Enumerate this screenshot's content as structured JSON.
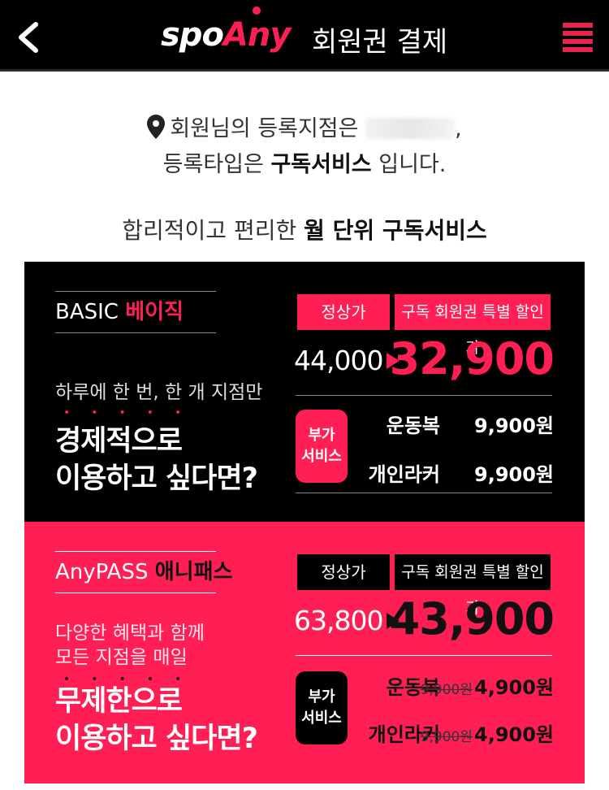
{
  "header": {
    "logo_left": "spo",
    "logo_right": "Any",
    "title": "회원권 결제"
  },
  "info": {
    "line1_text": "회원님의 등록지점은",
    "line2_prefix": "등록타입은",
    "line2_type": "구독서비스",
    "line2_suffix": "입니다."
  },
  "subtitle": {
    "prefix": "합리적이고 편리한",
    "bold": "월 단위 구독서비스"
  },
  "plans": {
    "basic": {
      "name_en": "BASIC",
      "name_ko": "베이직",
      "tagline": [
        "하루에 한 번, 한 개 지점만"
      ],
      "headline": [
        "경제적으로",
        "이용하고 싶다면?"
      ],
      "label_regular": "정상가",
      "label_discount": "구독 회원권 특별 할인가",
      "old_price": "44,000",
      "new_price": "32,900",
      "badge": [
        "부가",
        "서비스"
      ],
      "services": [
        {
          "name": "운동복",
          "old_price": "",
          "price": "9,900원"
        },
        {
          "name": "개인라커",
          "old_price": "",
          "price": "9,900원"
        }
      ]
    },
    "anypass": {
      "name_en": "AnyPASS",
      "name_ko": "애니패스",
      "tagline": [
        "다양한 혜택과 함께",
        "모든 지점을 매일"
      ],
      "headline": [
        "무제한으로",
        "이용하고 싶다면?"
      ],
      "label_regular": "정상가",
      "label_discount": "구독 회원권 특별 할인가",
      "old_price": "63,800",
      "new_price": "43,900",
      "badge": [
        "부가",
        "서비스"
      ],
      "services": [
        {
          "name": "운동복",
          "old_price": "9,900원",
          "price": "4,900원"
        },
        {
          "name": "개인라커",
          "old_price": "9,900원",
          "price": "4,900원"
        }
      ]
    }
  },
  "colors": {
    "accent": "#ff1f55",
    "header_bg": "#000000"
  }
}
